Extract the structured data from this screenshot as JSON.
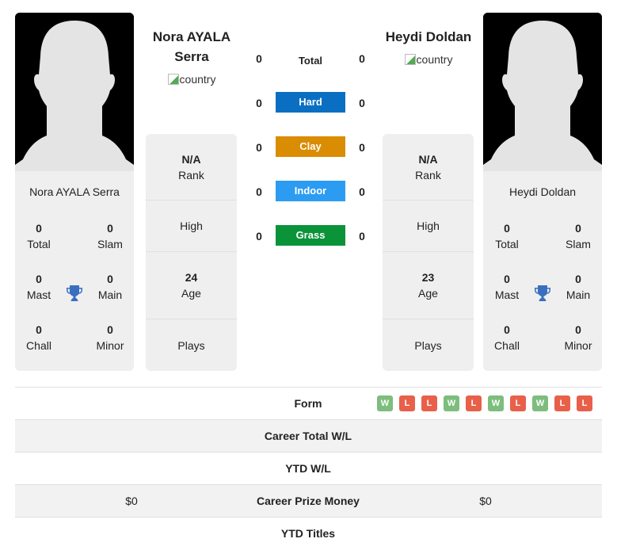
{
  "players": {
    "left": {
      "name_heading": "Nora AYALA Serra",
      "card_name": "Nora AYALA Serra",
      "country_alt": "country",
      "rank_value": "N/A",
      "rank_label": "Rank",
      "high_label": "High",
      "age_value": "24",
      "age_label": "Age",
      "plays_label": "Plays",
      "titles": {
        "total": {
          "value": "0",
          "label": "Total"
        },
        "slam": {
          "value": "0",
          "label": "Slam"
        },
        "mast": {
          "value": "0",
          "label": "Mast"
        },
        "main": {
          "value": "0",
          "label": "Main"
        },
        "chall": {
          "value": "0",
          "label": "Chall"
        },
        "minor": {
          "value": "0",
          "label": "Minor"
        }
      }
    },
    "right": {
      "name_heading": "Heydi Doldan",
      "card_name": "Heydi Doldan",
      "country_alt": "country",
      "rank_value": "N/A",
      "rank_label": "Rank",
      "high_label": "High",
      "age_value": "23",
      "age_label": "Age",
      "plays_label": "Plays",
      "titles": {
        "total": {
          "value": "0",
          "label": "Total"
        },
        "slam": {
          "value": "0",
          "label": "Slam"
        },
        "mast": {
          "value": "0",
          "label": "Mast"
        },
        "main": {
          "value": "0",
          "label": "Main"
        },
        "chall": {
          "value": "0",
          "label": "Chall"
        },
        "minor": {
          "value": "0",
          "label": "Minor"
        }
      }
    }
  },
  "h2h": [
    {
      "label": "Total",
      "left": "0",
      "right": "0",
      "color": ""
    },
    {
      "label": "Hard",
      "left": "0",
      "right": "0",
      "color": "#0a6fc2"
    },
    {
      "label": "Clay",
      "left": "0",
      "right": "0",
      "color": "#da8c03"
    },
    {
      "label": "Indoor",
      "left": "0",
      "right": "0",
      "color": "#2b9cf2"
    },
    {
      "label": "Grass",
      "left": "0",
      "right": "0",
      "color": "#0b9339"
    }
  ],
  "bottom": {
    "form_label": "Form",
    "form": [
      "W",
      "L",
      "L",
      "W",
      "L",
      "W",
      "L",
      "W",
      "L",
      "L"
    ],
    "rows": [
      {
        "label": "Career Total W/L",
        "left": "",
        "right": ""
      },
      {
        "label": "YTD W/L",
        "left": "",
        "right": ""
      },
      {
        "label": "Career Prize Money",
        "left": "$0",
        "right": "$0"
      },
      {
        "label": "YTD Titles",
        "left": "",
        "right": ""
      }
    ]
  },
  "colors": {
    "trophy": "#3a6fbf",
    "win": "#7dbd7d",
    "loss": "#e8604a"
  }
}
